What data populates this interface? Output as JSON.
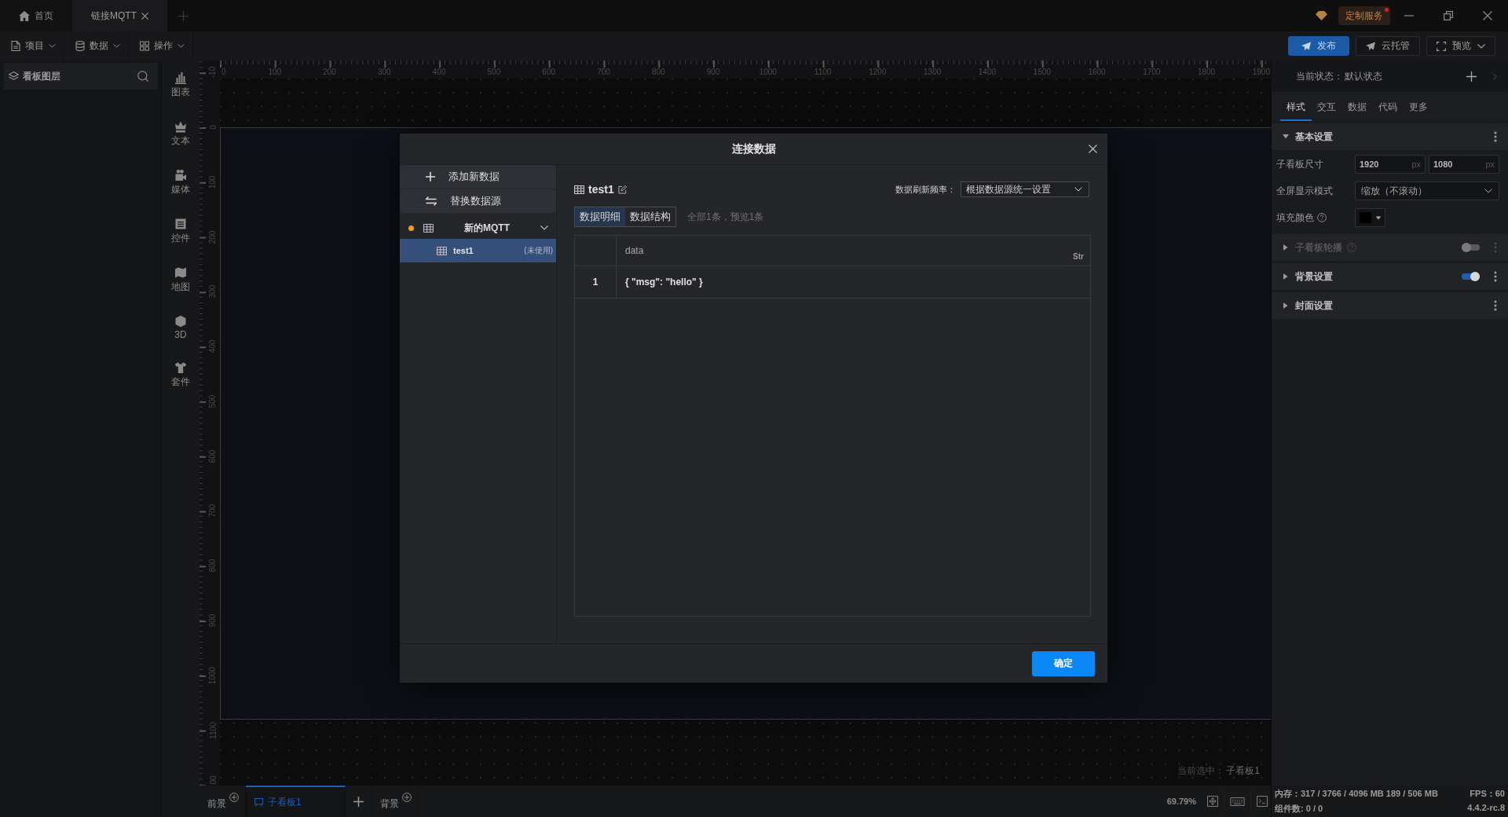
{
  "title_bar": {
    "tabs": [
      {
        "label": "首页",
        "selected": false,
        "closable": false
      },
      {
        "label": "链接MQTT",
        "selected": true,
        "closable": true
      }
    ],
    "service_badge": {
      "label": "定制服务",
      "notification": true
    }
  },
  "toolbar": {
    "menus": [
      {
        "label": "项目"
      },
      {
        "label": "数据"
      },
      {
        "label": "操作"
      }
    ],
    "actions": [
      {
        "label": "发布",
        "primary": true,
        "dropdown": false
      },
      {
        "label": "云托管",
        "primary": false,
        "dropdown": false
      },
      {
        "label": "预览",
        "primary": false,
        "dropdown": true
      }
    ]
  },
  "layers_panel": {
    "title": "看板图层"
  },
  "component_bar": {
    "items": [
      {
        "label": "图表"
      },
      {
        "label": "文本"
      },
      {
        "label": "媒体"
      },
      {
        "label": "控件"
      },
      {
        "label": "地图"
      },
      {
        "label": "3D"
      },
      {
        "label": "套件"
      }
    ]
  },
  "rulers": {
    "horizontal": [
      "0",
      "100",
      "200",
      "300",
      "400",
      "500",
      "600",
      "700",
      "800",
      "900",
      "1000",
      "1100",
      "1200",
      "1300",
      "1400",
      "1500",
      "1600",
      "1700",
      "1800",
      "1900"
    ],
    "vertical": [
      "-10",
      "0",
      "100",
      "200",
      "300",
      "400",
      "500",
      "600",
      "700",
      "800",
      "900",
      "1000",
      "1100",
      "00"
    ]
  },
  "canvas": {
    "selection_label": "当前选中：",
    "selection_value": "子看板1"
  },
  "page_bar": {
    "foreground": "前景",
    "boards": [
      {
        "label": "子看板1",
        "selected": true
      }
    ],
    "background": "背景",
    "zoom": "69.79%"
  },
  "properties_panel": {
    "state_label": "当前状态：",
    "state_value": "默认状态",
    "tabs": [
      {
        "label": "样式",
        "selected": true
      },
      {
        "label": "交互",
        "selected": false
      },
      {
        "label": "数据",
        "selected": false
      },
      {
        "label": "代码",
        "selected": false
      },
      {
        "label": "更多",
        "selected": false
      }
    ],
    "sections": [
      {
        "title": "基本设置",
        "expanded": true,
        "disabled": false,
        "help": false,
        "fields": [
          {
            "kind": "size",
            "label": "子看板尺寸",
            "help": false,
            "inputs": [
              {
                "value": "1920",
                "unit": "px"
              },
              {
                "value": "1080",
                "unit": "px"
              }
            ]
          },
          {
            "kind": "select",
            "label": "全屏显示模式",
            "help": false,
            "value": "缩放（不滚动）"
          },
          {
            "kind": "color",
            "label": "填充颜色",
            "help": true,
            "color": "#000000"
          }
        ]
      },
      {
        "title": "子看板轮播",
        "expanded": false,
        "disabled": true,
        "help": true,
        "toggle": {
          "on": false
        }
      },
      {
        "title": "背景设置",
        "expanded": false,
        "disabled": false,
        "help": false,
        "toggle": {
          "on": true
        }
      },
      {
        "title": "封面设置",
        "expanded": false,
        "disabled": false,
        "help": false
      }
    ]
  },
  "status": {
    "memory": "内存：317 / 3766 / 4096 MB 189 / 506 MB",
    "fps": "FPS：60",
    "components": "组件数: 0 / 0",
    "version": "4.4.2-rc.8"
  },
  "modal": {
    "title": "连接数据",
    "actions": [
      {
        "label": "添加新数据"
      },
      {
        "label": "替换数据源"
      }
    ],
    "sources": [
      {
        "name": "新的MQTT",
        "color": "#f5a000",
        "expanded": true,
        "children": [
          {
            "name": "test1",
            "note": "(未使用)",
            "selected": true
          }
        ]
      }
    ],
    "dataset": {
      "name": "test1",
      "refresh_label": "数据刷新频率：",
      "refresh_value": "根据数据源统一设置",
      "views": [
        {
          "label": "数据明细",
          "selected": true
        },
        {
          "label": "数据结构",
          "selected": false
        }
      ],
      "summary": "全部1条，预览1条",
      "columns": [
        {
          "label": "data",
          "type": "Str"
        }
      ],
      "rows": [
        {
          "index": "1",
          "cells": [
            "{ \"msg\": \"hello\" }"
          ]
        }
      ]
    },
    "confirm": "确定"
  }
}
